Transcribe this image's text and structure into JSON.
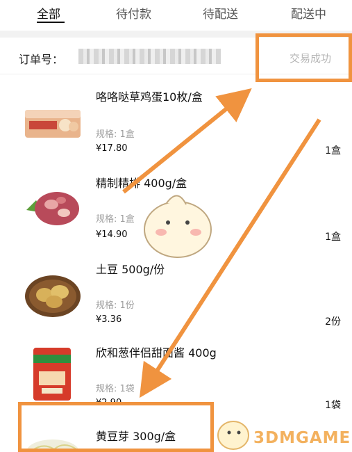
{
  "tabs": [
    {
      "label": "全部",
      "active": true
    },
    {
      "label": "待付款",
      "active": false
    },
    {
      "label": "待配送",
      "active": false
    },
    {
      "label": "配送中",
      "active": false
    }
  ],
  "order": {
    "label": "订单号：",
    "number_visible_fragment": "9481/000",
    "status": "交易成功"
  },
  "items": [
    {
      "name": "咯咯哒草鸡蛋10枚/盒",
      "spec": "规格: 1盒",
      "price": "¥17.80",
      "qty": "1盒",
      "thumb_icon": "egg-box-thumbnail"
    },
    {
      "name": "精制精排 400g/盒",
      "spec": "规格: 1盒",
      "price": "¥14.90",
      "qty": "1盒",
      "thumb_icon": "pork-ribs-thumbnail"
    },
    {
      "name": "土豆 500g/份",
      "spec": "规格: 1份",
      "price": "¥3.36",
      "qty": "2份",
      "thumb_icon": "potato-basket-thumbnail"
    },
    {
      "name": "欣和葱伴侣甜面酱 400g",
      "spec": "规格: 1袋",
      "price": "¥2.90",
      "qty": "1袋",
      "thumb_icon": "sauce-packet-thumbnail"
    },
    {
      "name": "黄豆芽 300g/盒",
      "spec": "",
      "price": "",
      "qty": "",
      "thumb_icon": "bean-sprouts-thumbnail"
    }
  ],
  "watermark": {
    "text": "3DMGAME"
  },
  "colors": {
    "annotation": "#f0933f",
    "status": "#b5b5b5",
    "active_tab": "#111111"
  }
}
